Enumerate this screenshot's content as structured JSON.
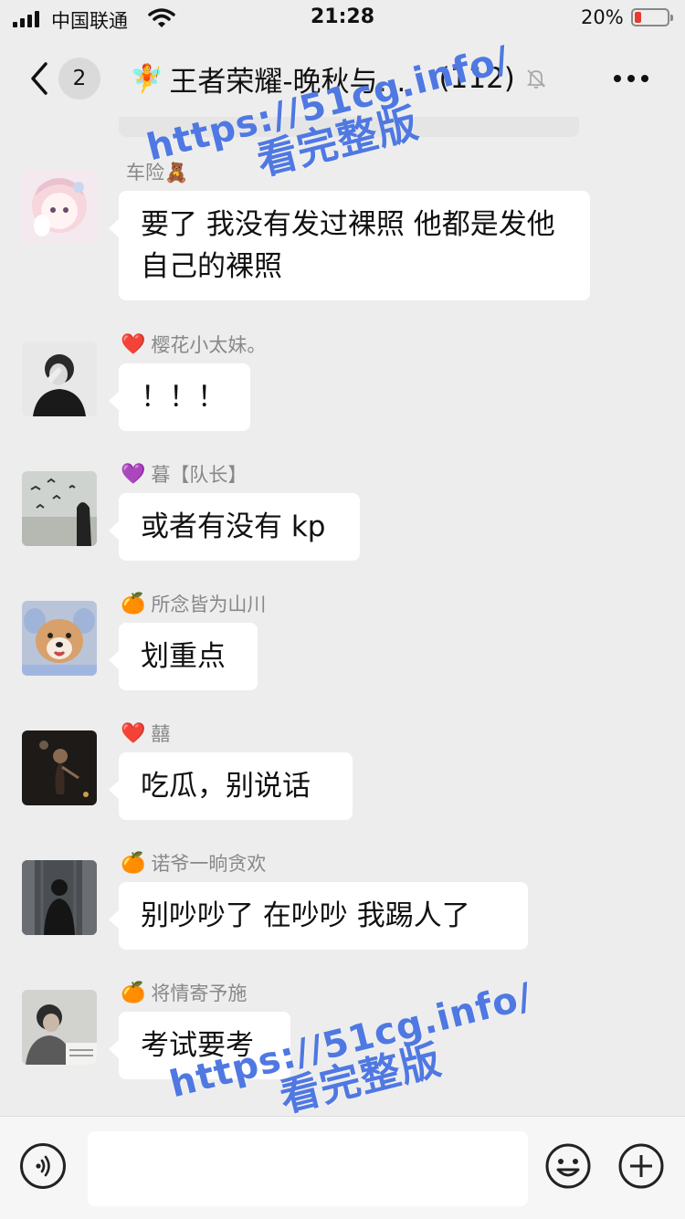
{
  "status": {
    "carrier": "中国联通",
    "time": "21:28",
    "battery": "20%",
    "battery_level": 0.2
  },
  "header": {
    "back_count": "2",
    "title_emoji": "🧚",
    "title": "王者荣耀-晚秋与…",
    "member_count": "(112)",
    "muted": true
  },
  "colors": {
    "bubble": "#ffffff",
    "background": "#ededed",
    "watermark": "#4f78e2",
    "battery_low": "#e63b2e"
  },
  "messages": [
    {
      "sender_emoji": "",
      "sender": "车险🧸",
      "text": "要了 我没有发过裸照 他都是发他自己的裸照",
      "avatar": "anime-girl-avatar"
    },
    {
      "sender_emoji": "❤️",
      "sender": "樱花小太妹。",
      "text": "！！！",
      "avatar": "girl-bw-avatar"
    },
    {
      "sender_emoji": "💜",
      "sender": "暮【队长】",
      "text": "或者有没有 kp",
      "avatar": "birds-avatar"
    },
    {
      "sender_emoji": "🍊",
      "sender": "所念皆为山川",
      "text": "划重点",
      "avatar": "dog-avatar"
    },
    {
      "sender_emoji": "❤️",
      "sender": "囍",
      "text": "吃瓜，别说话",
      "avatar": "dancer-avatar"
    },
    {
      "sender_emoji": "🍊",
      "sender": "诺爷一晌贪欢",
      "text": "别吵吵了 在吵吵 我踢人了",
      "avatar": "man-silhouette-avatar"
    },
    {
      "sender_emoji": "🍊",
      "sender": "将情寄予施",
      "text": "考试要考",
      "avatar": "boy-desk-avatar"
    }
  ],
  "watermark": {
    "url": "https://51cg.info/",
    "text": "看完整版"
  },
  "input": {
    "placeholder": ""
  }
}
